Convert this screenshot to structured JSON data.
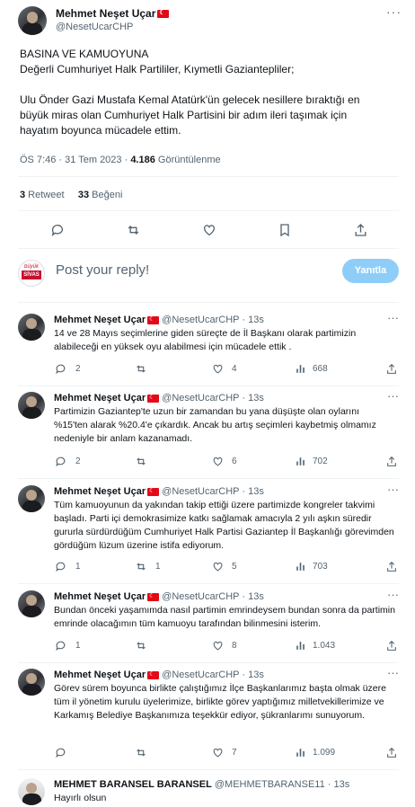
{
  "main": {
    "name": "Mehmet Neşet Uçar",
    "handle": "@NesetUcarCHP",
    "text_lines": [
      "BASINA VE KAMUOYUNA",
      "Değerli Cumhuriyet Halk Partililer, Kıymetli Gaziantepliler;",
      "",
      "Ulu Önder Gazi Mustafa Kemal Atatürk'ün gelecek nesillere bıraktığı en",
      "büyük miras olan Cumhuriyet Halk Partisini bir adım ileri taşımak için",
      "hayatım boyunca mücadele ettim."
    ],
    "time": "ÖS 7:46 · 31 Tem 2023 · ",
    "views_count": "4.186",
    "views_label": " Görüntülenme",
    "retweets_count": "3",
    "retweets_label": " Retweet",
    "likes_count": "33",
    "likes_label": " Beğeni"
  },
  "reply_box": {
    "placeholder": "Post your reply!",
    "button": "Yanıtla",
    "avatar_text_top": "büyük",
    "avatar_text_main": "SİVAS"
  },
  "replies": [
    {
      "name": "Mehmet Neşet Uçar",
      "handle": "@NesetUcarCHP · 13s",
      "text": "14 ve 28 Mayıs seçimlerine giden süreçte de İl Başkanı olarak partimizin alabileceği en yüksek oyu alabilmesi için mücadele ettik .",
      "replies": "2",
      "retweets": "",
      "likes": "4",
      "views": "668"
    },
    {
      "name": "Mehmet Neşet Uçar",
      "handle": "@NesetUcarCHP · 13s",
      "text": "Partimizin Gaziantep'te uzun bir zamandan bu yana düşüşte olan oylarını %15'ten alarak %20.4'e çıkardık. Ancak bu artış seçimleri kaybetmiş olmamız nedeniyle bir anlam kazanamadı.",
      "replies": "2",
      "retweets": "",
      "likes": "6",
      "views": "702"
    },
    {
      "name": "Mehmet Neşet Uçar",
      "handle": "@NesetUcarCHP · 13s",
      "text": "Tüm kamuoyunun da yakından takip ettiği üzere partimizde kongreler takvimi başladı. Parti içi demokrasimize katkı sağlamak amacıyla 2 yılı aşkın süredir gururla sürdürdüğüm Cumhuriyet Halk Partisi Gaziantep İl Başkanlığı görevimden gördüğüm lüzum üzerine istifa ediyorum.",
      "replies": "1",
      "retweets": "1",
      "likes": "5",
      "views": "703"
    },
    {
      "name": "Mehmet Neşet Uçar",
      "handle": "@NesetUcarCHP · 13s",
      "text": "Bundan önceki yaşamımda nasıl partimin emrindeysem bundan sonra da partimin emrinde olacağımın tüm kamuoyu tarafından bilinmesini isterim.",
      "replies": "1",
      "retweets": "",
      "likes": "8",
      "views": "1.043"
    },
    {
      "name": "Mehmet Neşet Uçar",
      "handle": "@NesetUcarCHP · 13s",
      "text": "Görev sürem boyunca birlikte çalıştığımız İlçe Başkanlarımız başta olmak üzere tüm il yönetim kurulu üyelerimize, birlikte görev yaptığımız milletvekillerimize ve Karkamış Belediye Başkanımıza teşekkür ediyor, şükranlarımı sunuyorum.",
      "replies": "",
      "retweets": "",
      "likes": "7",
      "views": "1.099"
    },
    {
      "name": "MEHMET BARANSEL BARANSEL",
      "handle": "@MEHMETBARANSE11 · 13s",
      "text": "Hayırlı olsun"
    }
  ]
}
